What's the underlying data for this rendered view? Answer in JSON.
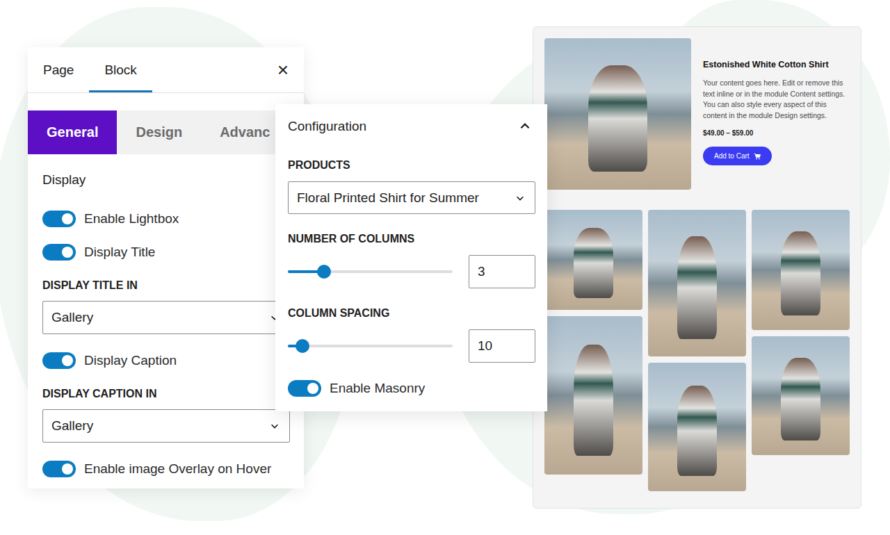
{
  "block_panel": {
    "tabs": [
      {
        "label": "Page",
        "selected": false
      },
      {
        "label": "Block",
        "selected": true
      }
    ],
    "close": "×",
    "subtabs": [
      {
        "label": "General",
        "selected": true
      },
      {
        "label": "Design",
        "selected": false
      },
      {
        "label": "Advanc",
        "selected": false
      }
    ],
    "section": {
      "title": "Display",
      "expanded": true
    },
    "fields": [
      {
        "kind": "toggle",
        "label": "Enable Lightbox",
        "on": true
      },
      {
        "kind": "toggle",
        "label": "Display Title",
        "on": true
      },
      {
        "kind": "select",
        "label": "DISPLAY TITLE IN",
        "value": "Gallery"
      },
      {
        "kind": "toggle",
        "label": "Display Caption",
        "on": true
      },
      {
        "kind": "select",
        "label": "DISPLAY CAPTION IN",
        "value": "Gallery"
      },
      {
        "kind": "toggle",
        "label": "Enable image Overlay on Hover",
        "on": true
      }
    ]
  },
  "configuration": {
    "title": "Configuration",
    "expanded": true,
    "fields": [
      {
        "kind": "select",
        "label": "PRODUCTS",
        "value": "Floral Printed Shirt for Summer"
      },
      {
        "kind": "slider",
        "label": "NUMBER OF COLUMNS",
        "level": 0.22,
        "value": "3"
      },
      {
        "kind": "slider",
        "label": "COLUMN SPACING",
        "level": 0.09,
        "value": "10"
      },
      {
        "kind": "toggle",
        "label": "Enable Masonry",
        "on": true
      }
    ]
  },
  "preview": {
    "product": {
      "title": "Estonished White Cotton Shirt",
      "description": "Your content goes here. Edit or remove this text inline or in the module Content settings. You can also style every aspect of this content in the module Design settings.",
      "price": "$49.00 – $59.00",
      "button": "Add to Cart"
    }
  }
}
